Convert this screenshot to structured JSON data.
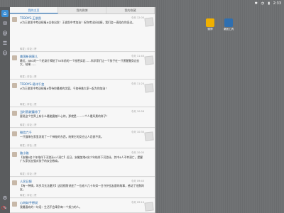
{
  "status": {
    "time": "2:33",
    "icons": [
      "bluetooth-icon",
      "wifi-icon",
      "battery-icon"
    ]
  },
  "tabs": [
    {
      "label": "我的主页",
      "active": true
    },
    {
      "label": "我的微博",
      "active": false
    },
    {
      "label": "我的收藏",
      "active": false
    }
  ],
  "desktop_icons": [
    {
      "label": "微博",
      "color": "#f0b000"
    },
    {
      "label": "桌面工具",
      "color": "#2f6fb0"
    }
  ],
  "posts": [
    {
      "name": "TFBOYS-王俊凯",
      "time": "今天 12:00",
      "text": "#为王俊凯中考送祝福#全体出发！王俊凯中考加油！祝你考出好成绩，我们会一直陪在你身边。",
      "repost": "",
      "actions": "转发 | 评论 | 赞"
    },
    {
      "name": "美国新闻事儿",
      "time": "今天 11:40",
      "text": "最近，BBC的一个纪录片揭秘了50年前的一个秘密实验……科学家们让一个孩子在一只黑猩猩身边长大，结果……",
      "repost": "",
      "actions": "转发 | 评论 | 赞"
    },
    {
      "name": "TFBOYS-易烊千玺",
      "time": "今天 11:20",
      "text": "#为王俊凯中考送祝福#等待你最美的笑容，千玺带着大家一起为你加油！",
      "repost": "",
      "actions": "转发 | 评论 | 赞"
    },
    {
      "name": "当时我就震惊了",
      "time": "今天 10:58",
      "text": "要说这个世界上有什么最能震撼人心的，那就是……一个人看风景的样子！",
      "repost": "",
      "actions": "转发 | 评论 | 赞"
    },
    {
      "name": "微信六千",
      "time": "今天 10:30",
      "text": "一只猫咪在家里发现了一个神秘的东西，结果它的反应让人忍俊不禁。",
      "repost": "",
      "actions": "转发 | 评论 | 赞"
    },
    {
      "name": "路小路",
      "time": "今天 10:05",
      "text": "【安徽6名少年结伴下河游泳4人溺亡】近日，安徽某地6名少年结伴下河游泳，其中4人不幸溺亡，提醒广大家长加强对孩子的安全教育。",
      "repost": "",
      "actions": "转发 | 评论 | 赞"
    },
    {
      "name": "人民日报",
      "time": "今天 09:40",
      "text": "【有一种情，叫岁月无法磨灭】这段视频讲述了一位老人几十年如一日守护战友墓的故事，感动了无数网友。",
      "repost": "",
      "actions": "转发 | 评论 | 赞"
    },
    {
      "name": "心碎妹子想说",
      "time": "今天 09:10",
      "text": "我最喜欢的一句话：生活不会辜负每一个努力的人。",
      "repost": "",
      "actions": "转发 | 评论 | 赞"
    }
  ]
}
